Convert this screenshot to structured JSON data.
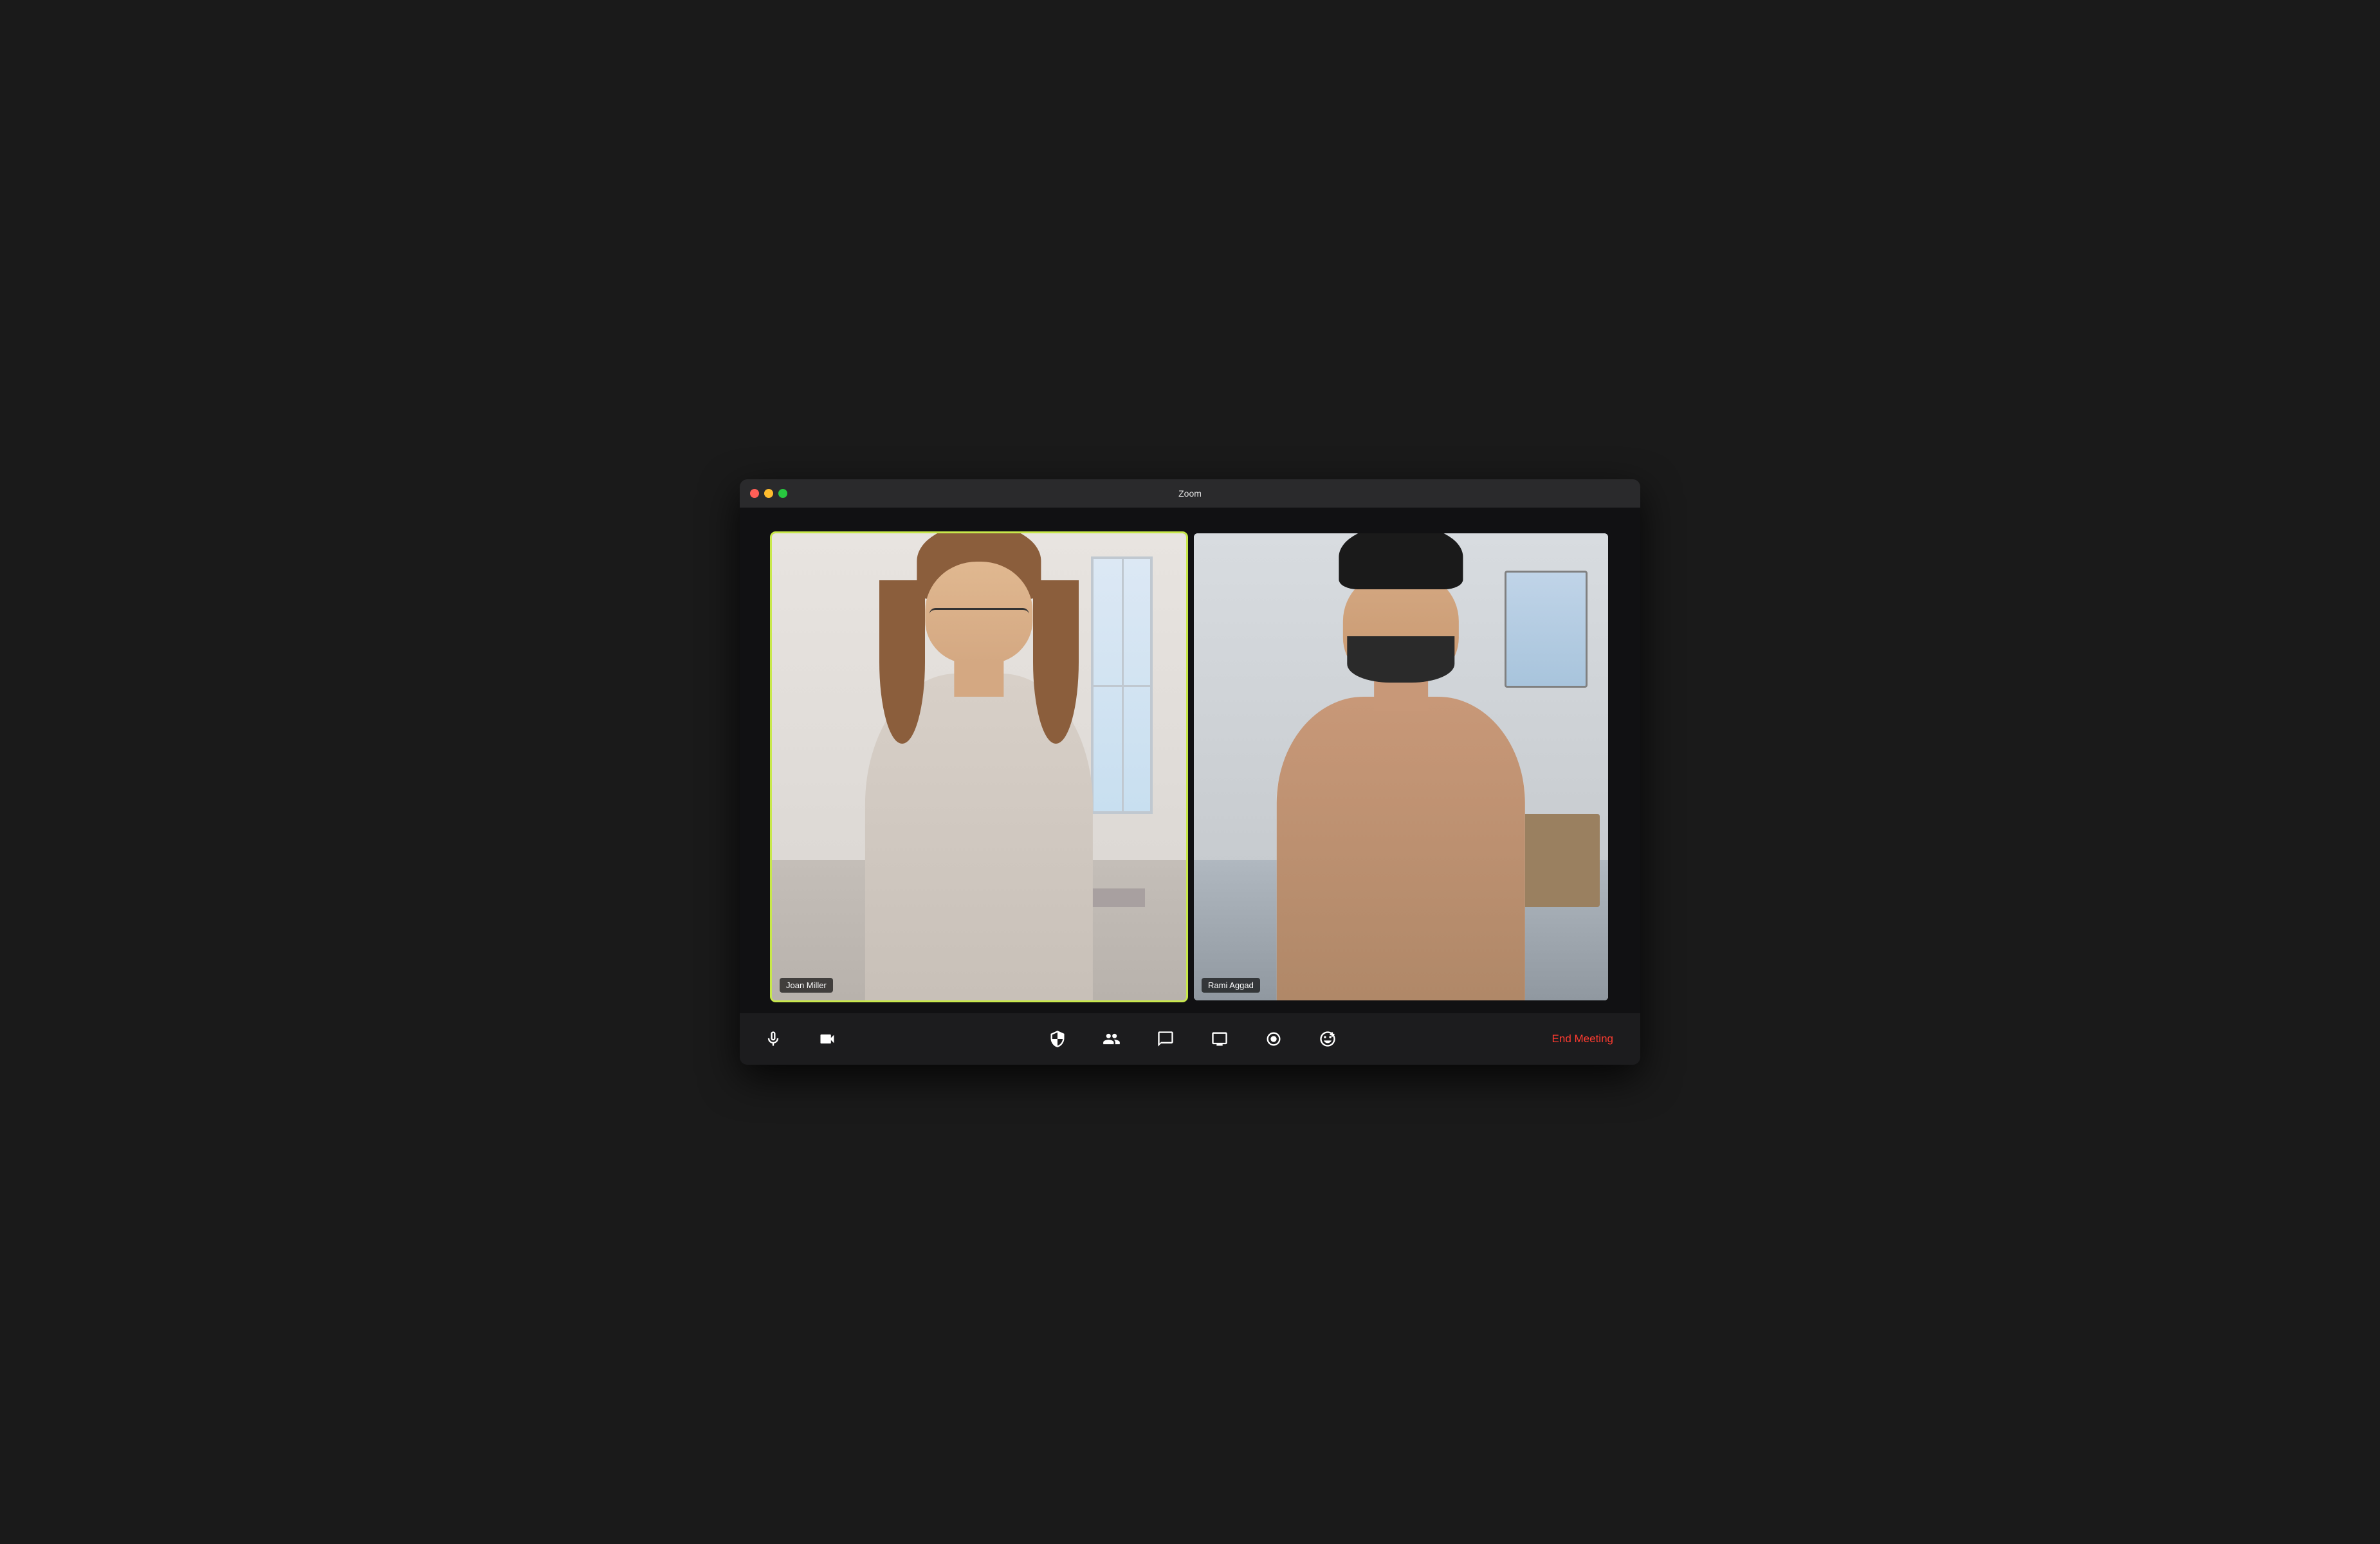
{
  "window": {
    "title": "Zoom",
    "controls": {
      "close": "close",
      "minimize": "minimize",
      "maximize": "maximize"
    }
  },
  "participants": [
    {
      "name": "Joan Miller",
      "active": true,
      "position": "left"
    },
    {
      "name": "Rami Aggad",
      "active": false,
      "position": "right"
    }
  ],
  "toolbar": {
    "buttons": [
      {
        "id": "mute",
        "label": "Mute",
        "icon": "microphone-icon"
      },
      {
        "id": "video",
        "label": "Stop Video",
        "icon": "camera-icon"
      },
      {
        "id": "security",
        "label": "Security",
        "icon": "shield-icon"
      },
      {
        "id": "participants",
        "label": "Participants",
        "icon": "participants-icon"
      },
      {
        "id": "chat",
        "label": "Chat",
        "icon": "chat-icon"
      },
      {
        "id": "share",
        "label": "Share Screen",
        "icon": "share-icon"
      },
      {
        "id": "record",
        "label": "Record",
        "icon": "record-icon"
      },
      {
        "id": "reactions",
        "label": "Reactions",
        "icon": "reactions-icon"
      }
    ],
    "end_meeting_label": "End Meeting"
  },
  "colors": {
    "active_border": "#c8e84b",
    "end_meeting": "#ff3b30",
    "toolbar_bg": "#1c1c1e",
    "titlebar_bg": "#2a2a2c",
    "text_white": "#ffffff"
  }
}
